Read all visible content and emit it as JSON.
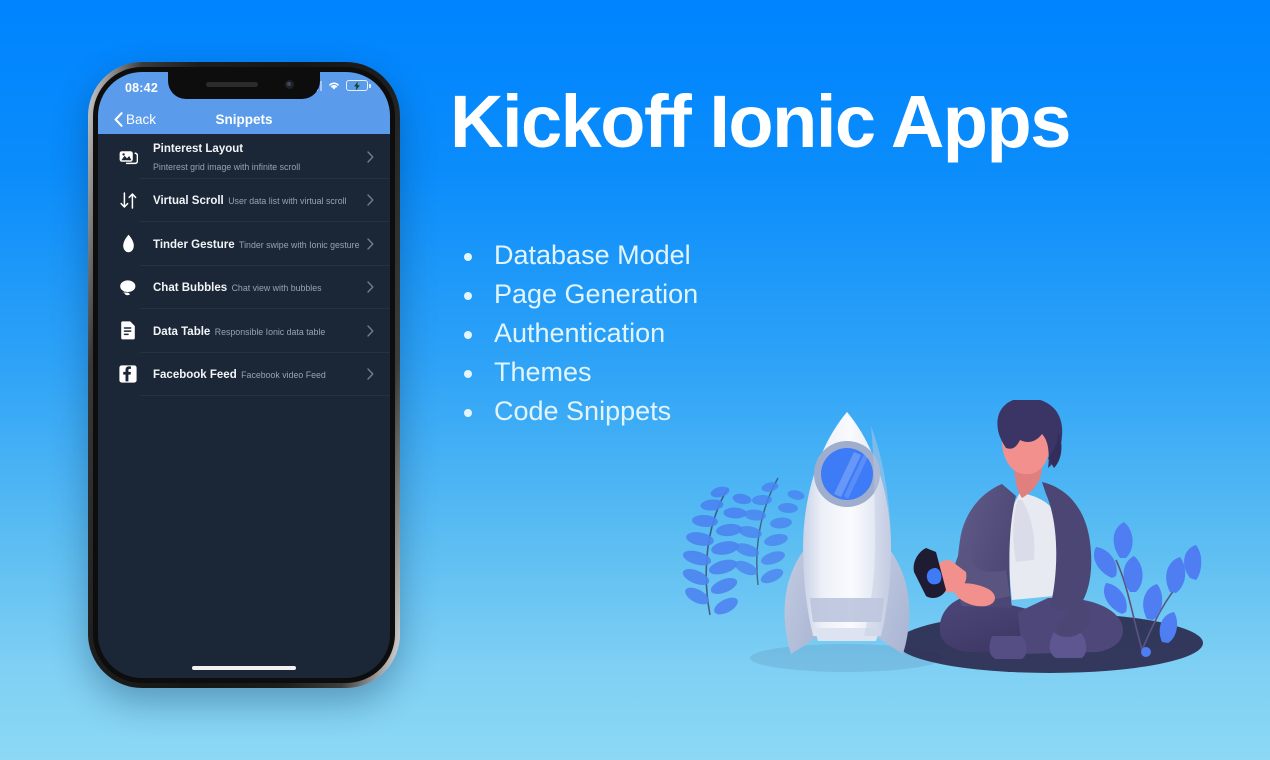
{
  "background": {
    "gradient_top": "#0084FF",
    "gradient_bottom": "#8CD8F5"
  },
  "hero": {
    "headline": "Kickoff Ionic Apps",
    "headline_color": "#FFFFFF",
    "features": [
      {
        "label": "Database Model"
      },
      {
        "label": "Page Generation"
      },
      {
        "label": "Authentication"
      },
      {
        "label": "Themes"
      },
      {
        "label": "Code Snippets"
      }
    ],
    "feature_text_color": "#E3F4FD"
  },
  "phone": {
    "status_bar": {
      "time": "08:42",
      "location_icon": "location-arrow-icon",
      "signal_icon": "cellular-signal-icon",
      "wifi_icon": "wifi-icon",
      "battery_icon": "battery-charging-icon",
      "battery_color": "#4AD15E",
      "background": "#5B9BEB"
    },
    "nav_bar": {
      "back_label": "Back",
      "back_icon": "chevron-left-icon",
      "title": "Snippets",
      "background": "#5B9BEB"
    },
    "list_background": "#1B2736",
    "snippets": [
      {
        "icon": "images-icon",
        "title": "Pinterest Layout",
        "subtitle": "Pinterest grid image with infinite scroll",
        "chevron": "chevron-right-icon"
      },
      {
        "icon": "swap-vertical-icon",
        "title": "Virtual Scroll",
        "subtitle": "User data list with virtual scroll",
        "chevron": "chevron-right-icon"
      },
      {
        "icon": "flame-icon",
        "title": "Tinder Gesture",
        "subtitle": "Tinder swipe with Ionic gesture",
        "chevron": "chevron-right-icon"
      },
      {
        "icon": "chatbubbles-icon",
        "title": "Chat Bubbles",
        "subtitle": "Chat view with bubbles",
        "chevron": "chevron-right-icon"
      },
      {
        "icon": "document-text-icon",
        "title": "Data Table",
        "subtitle": "Responsible Ionic data table",
        "chevron": "chevron-right-icon"
      },
      {
        "icon": "facebook-logo-icon",
        "title": "Facebook Feed",
        "subtitle": "Facebook video Feed",
        "chevron": "chevron-right-icon"
      }
    ],
    "home_indicator": "home-indicator-bar"
  },
  "illustration": {
    "rocket": {
      "name": "rocket-illustration",
      "body_color": "#F2F4FA",
      "fin_color": "#B8C2DC",
      "window_color": "#3D7BF7",
      "window_ring_color": "#9FAECC"
    },
    "person": {
      "name": "person-sitting-with-phone-illustration",
      "hair_color": "#3B3566",
      "skin_color": "#F2908E",
      "jacket_color": "#5A5580",
      "shirt_color": "#E8EAF2",
      "pants_color": "#443D6B",
      "phone_color": "#1E1B33"
    },
    "fern": {
      "name": "fern-plant-decoration",
      "leaf_color": "#4A7CF0"
    },
    "sprig": {
      "name": "sprig-plant-decoration",
      "leaf_color": "#4F7DF2"
    },
    "ground_shadow": {
      "name": "ground-shadow-ellipse",
      "color": "#2D2B4E"
    }
  }
}
